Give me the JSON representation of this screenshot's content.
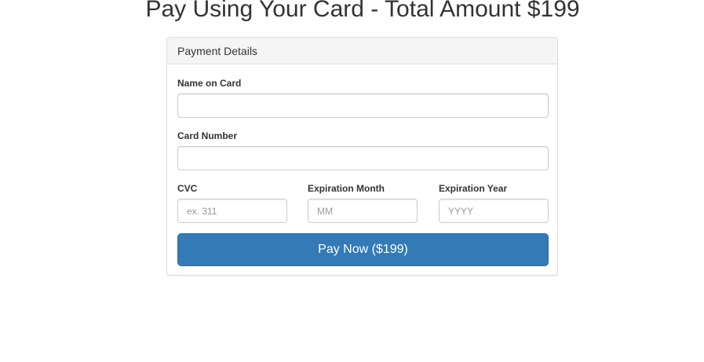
{
  "page": {
    "title": "Pay Using Your Card - Total Amount $199"
  },
  "panel": {
    "heading": "Payment Details"
  },
  "form": {
    "name_on_card": {
      "label": "Name on Card",
      "value": "",
      "placeholder": ""
    },
    "card_number": {
      "label": "Card Number",
      "value": "",
      "placeholder": ""
    },
    "cvc": {
      "label": "CVC",
      "value": "",
      "placeholder": "ex. 311"
    },
    "expiration_month": {
      "label": "Expiration Month",
      "value": "",
      "placeholder": "MM"
    },
    "expiration_year": {
      "label": "Expiration Year",
      "value": "",
      "placeholder": "YYYY"
    },
    "submit_label": "Pay Now ($199)"
  },
  "colors": {
    "primary_button": "#337ab7",
    "panel_heading_bg": "#f5f5f5",
    "border": "#dddddd"
  }
}
